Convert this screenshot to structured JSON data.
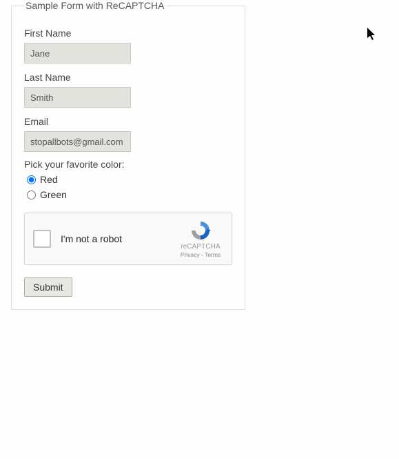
{
  "form": {
    "legend": "Sample Form with ReCAPTCHA",
    "first_name": {
      "label": "First Name",
      "value": "Jane"
    },
    "last_name": {
      "label": "Last Name",
      "value": "Smith"
    },
    "email": {
      "label": "Email",
      "value": "stopallbots@gmail.com"
    },
    "color": {
      "question": "Pick your favorite color:",
      "options": {
        "red": "Red",
        "green": "Green"
      },
      "selected": "red"
    },
    "recaptcha": {
      "label": "I'm not a robot",
      "brand": "reCAPTCHA",
      "privacy": "Privacy",
      "terms": "Terms"
    },
    "submit_label": "Submit"
  }
}
